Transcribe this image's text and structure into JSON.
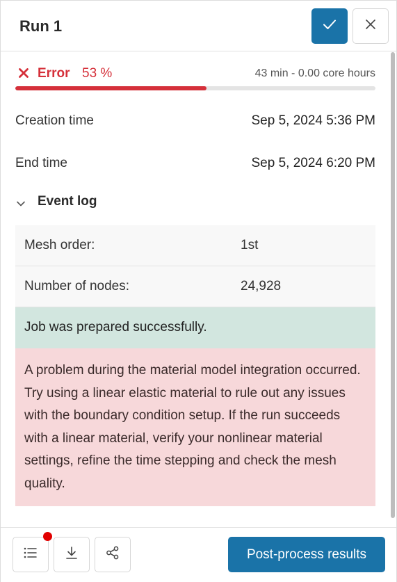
{
  "header": {
    "title": "Run 1",
    "confirm_icon": "check-icon",
    "close_icon": "close-icon"
  },
  "status": {
    "icon": "x-icon",
    "label": "Error",
    "percent_text": "53 %",
    "progress_fraction": 0.53,
    "duration": "43 min - 0.00 core hours",
    "color": "#d5303a"
  },
  "info": [
    {
      "label": "Creation time",
      "value": "Sep 5, 2024 5:36 PM"
    },
    {
      "label": "End time",
      "value": "Sep 5, 2024 6:20 PM"
    }
  ],
  "event_log": {
    "title": "Event log",
    "toggle_icon": "chevron-down-icon",
    "rows": [
      {
        "key": "Mesh order:",
        "value": "1st"
      },
      {
        "key": "Number of nodes:",
        "value": "24,928"
      }
    ],
    "success_message": "Job was prepared successfully.",
    "error_message": "A problem during the material model integration occurred. Try using a linear elastic material to rule out any issues with the boundary condition setup. If the run succeeds with a linear material, verify your nonlinear material settings, refine the time stepping and check the mesh quality."
  },
  "footer": {
    "icons": [
      "list-icon",
      "download-icon",
      "share-icon"
    ],
    "post_process_label": "Post-process results",
    "accent": "#1a73a8"
  }
}
